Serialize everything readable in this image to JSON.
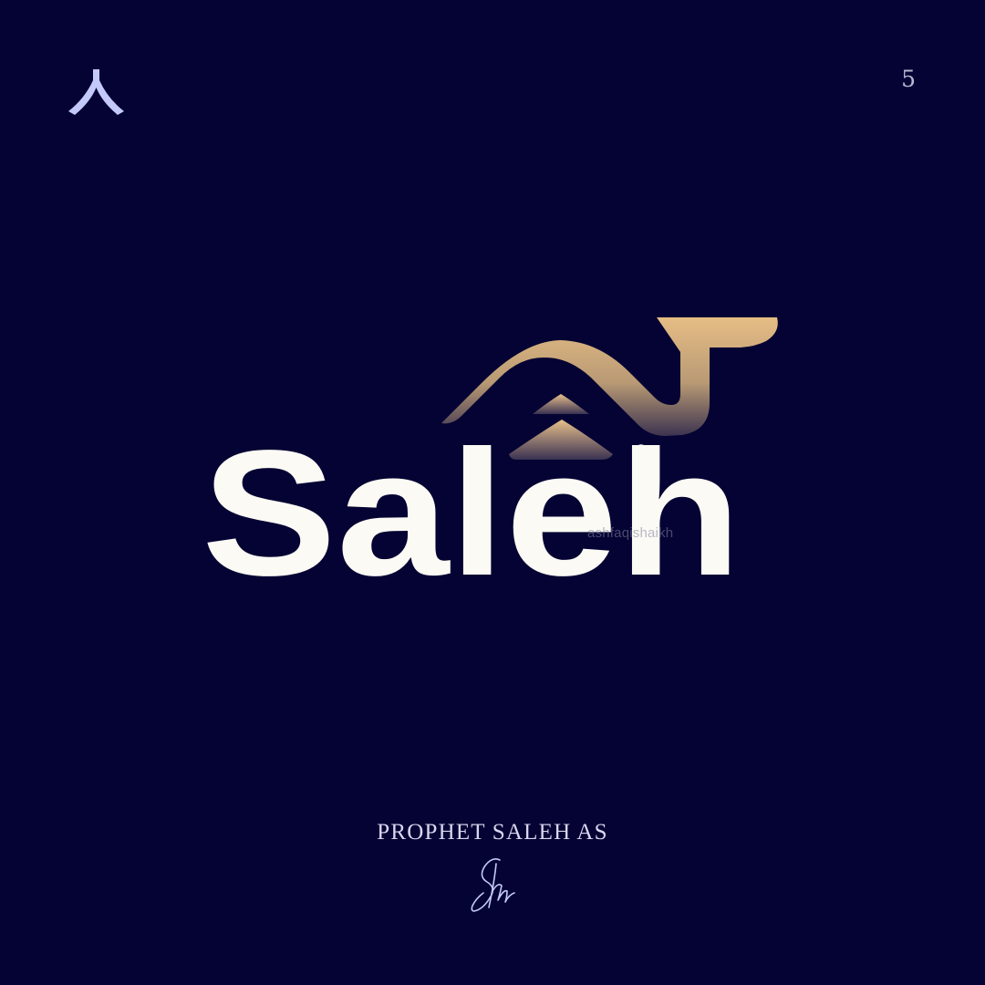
{
  "page_number": "5",
  "logo": {
    "wordmark": "Saleh",
    "watermark": "ashfaqishaikh"
  },
  "caption": "PROPHET SALEH AS",
  "colors": {
    "background": "#050333",
    "accent_gold": "#e6bd85",
    "wordmark": "#fbfaf4",
    "mark_lavender": "#c4c9fb"
  },
  "icons": {
    "corner_mark": "chevron-up-mark",
    "signature": "handwritten-signature"
  }
}
